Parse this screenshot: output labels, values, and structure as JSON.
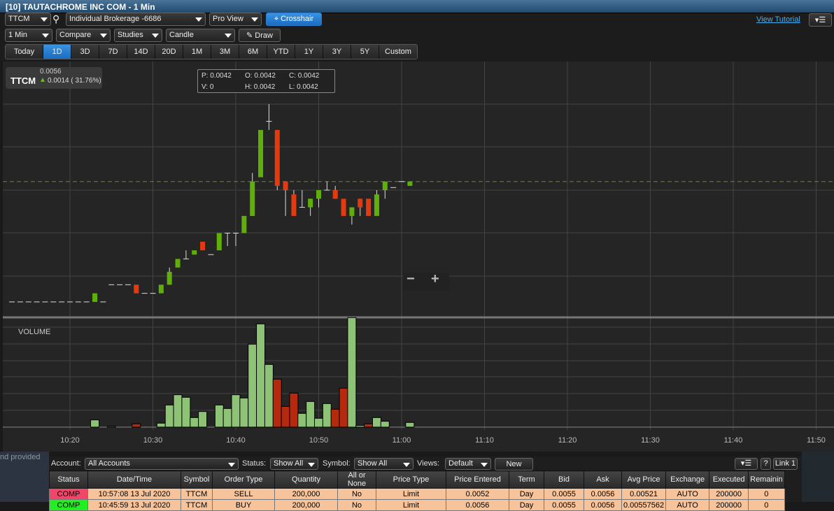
{
  "window_title": "[10] TAUTACHROME INC COM - 1 Min",
  "toolbar": {
    "symbol": "TTCM",
    "account": "Individual Brokerage -6686",
    "view": "Pro View",
    "crosshair": "Crosshair",
    "view_tutorial": "View Tutorial",
    "interval": "1 Min",
    "compare": "Compare",
    "studies": "Studies",
    "chart_type": "Candle",
    "draw": "Draw",
    "ranges": [
      "Today",
      "1D",
      "3D",
      "7D",
      "14D",
      "20D",
      "1M",
      "3M",
      "6M",
      "YTD",
      "1Y",
      "3Y",
      "5Y",
      "Custom"
    ],
    "active_range": "1D"
  },
  "quote": {
    "symbol": "TTCM",
    "last": "0.0056",
    "change": "0.0014 ( 31.76%)"
  },
  "ohlc_box": {
    "p": "P: 0.0042",
    "o": "O: 0.0042",
    "c": "C: 0.0042",
    "v": "V: 0",
    "h": "H: 0.0042",
    "l": "L: 0.0042"
  },
  "zoom": {
    "minus": "−",
    "plus": "+"
  },
  "colors": {
    "up": "#5fae0a",
    "down": "#e43a10",
    "vol_up": "#8dc277",
    "vol_down": "#b52a0e",
    "ref_line": "#6a8a2a"
  },
  "chart_data": {
    "type": "candlestick",
    "volume_label": "VOLUME",
    "reference_price": 0.0056,
    "price_range": [
      0.00385,
      0.00675
    ],
    "x_ticks": [
      "10:20",
      "10:30",
      "10:40",
      "10:50",
      "11:00",
      "11:10",
      "11:20",
      "11:30",
      "11:40",
      "11:50"
    ],
    "candles": [
      [
        13,
        0.0042,
        0.0042,
        0.0042,
        0.0042
      ],
      [
        14,
        0.0042,
        0.0042,
        0.0042,
        0.0042
      ],
      [
        15,
        0.0042,
        0.0042,
        0.0042,
        0.0042
      ],
      [
        16,
        0.0042,
        0.0042,
        0.0042,
        0.0042
      ],
      [
        17,
        0.0042,
        0.0042,
        0.0042,
        0.0042
      ],
      [
        18,
        0.0042,
        0.0042,
        0.0042,
        0.0042
      ],
      [
        19,
        0.0042,
        0.0042,
        0.0042,
        0.0042
      ],
      [
        20,
        0.0042,
        0.0042,
        0.0042,
        0.0042
      ],
      [
        21,
        0.0042,
        0.0042,
        0.0042,
        0.0042
      ],
      [
        22,
        0.0042,
        0.0042,
        0.0042,
        0.0042
      ],
      [
        23,
        0.0042,
        0.0043,
        0.0042,
        0.0043
      ],
      [
        24,
        0.0042,
        0.0042,
        0.0042,
        0.0042
      ],
      [
        25,
        0.0044,
        0.0044,
        0.0044,
        0.0044
      ],
      [
        26,
        0.0044,
        0.0044,
        0.0044,
        0.0044
      ],
      [
        27,
        0.0044,
        0.0044,
        0.0044,
        0.0044
      ],
      [
        28,
        0.0044,
        0.0044,
        0.0043,
        0.0043
      ],
      [
        29,
        0.0043,
        0.0043,
        0.0043,
        0.0043
      ],
      [
        30,
        0.0043,
        0.0043,
        0.0043,
        0.0043
      ],
      [
        31,
        0.0043,
        0.0044,
        0.0043,
        0.0044
      ],
      [
        32,
        0.0044,
        0.0046,
        0.0044,
        0.00455
      ],
      [
        33,
        0.0046,
        0.0047,
        0.0046,
        0.0047
      ],
      [
        34,
        0.0047,
        0.0048,
        0.0047,
        0.0047
      ],
      [
        35,
        0.00475,
        0.0048,
        0.00475,
        0.0048
      ],
      [
        36,
        0.0049,
        0.0049,
        0.0048,
        0.0048
      ],
      [
        37,
        0.00475,
        0.00475,
        0.00475,
        0.00475
      ],
      [
        38,
        0.0048,
        0.005,
        0.0048,
        0.005
      ],
      [
        39,
        0.005,
        0.005,
        0.00485,
        0.005
      ],
      [
        40,
        0.005,
        0.005,
        0.00485,
        0.005
      ],
      [
        41,
        0.005,
        0.0052,
        0.005,
        0.0052
      ],
      [
        42,
        0.0052,
        0.0057,
        0.0052,
        0.0056
      ],
      [
        43,
        0.00565,
        0.0062,
        0.00565,
        0.0062
      ],
      [
        44,
        0.0063,
        0.0065,
        0.0062,
        0.0063
      ],
      [
        45,
        0.0062,
        0.0062,
        0.0055,
        0.00555
      ],
      [
        46,
        0.0056,
        0.0056,
        0.0052,
        0.0055
      ],
      [
        47,
        0.00545,
        0.0055,
        0.0052,
        0.0052
      ],
      [
        48,
        0.0053,
        0.0055,
        0.0053,
        0.0053
      ],
      [
        49,
        0.0053,
        0.0054,
        0.0052,
        0.0054
      ],
      [
        50,
        0.0054,
        0.0055,
        0.0053,
        0.0055
      ],
      [
        51,
        0.0055,
        0.0056,
        0.0055,
        0.0055
      ],
      [
        52,
        0.0055,
        0.00555,
        0.0054,
        0.0054
      ],
      [
        53,
        0.0054,
        0.0054,
        0.0052,
        0.0052
      ],
      [
        54,
        0.0052,
        0.0053,
        0.0051,
        0.0053
      ],
      [
        55,
        0.0054,
        0.0054,
        0.0052,
        0.0053
      ],
      [
        56,
        0.0054,
        0.0054,
        0.0052,
        0.0052
      ],
      [
        57,
        0.0052,
        0.0055,
        0.0052,
        0.00545
      ],
      [
        58,
        0.0055,
        0.0056,
        0.0054,
        0.0056
      ],
      [
        59,
        0.00553,
        0.00553,
        0.00553,
        0.00553
      ],
      [
        60,
        0.0056,
        0.0056,
        0.0056,
        0.0056
      ],
      [
        61,
        0.00555,
        0.0056,
        0.00555,
        0.0056
      ]
    ],
    "volume": [
      [
        23,
        31,
        "up"
      ],
      [
        25,
        4,
        "up"
      ],
      [
        28,
        14,
        "down"
      ],
      [
        31,
        17,
        "up"
      ],
      [
        32,
        95,
        "up"
      ],
      [
        33,
        139,
        "up"
      ],
      [
        34,
        128,
        "up"
      ],
      [
        35,
        41,
        "up"
      ],
      [
        36,
        67,
        "up"
      ],
      [
        38,
        95,
        "up"
      ],
      [
        39,
        80,
        "up"
      ],
      [
        40,
        139,
        "up"
      ],
      [
        41,
        125,
        "up"
      ],
      [
        42,
        356,
        "up"
      ],
      [
        43,
        443,
        "up"
      ],
      [
        44,
        269,
        "up"
      ],
      [
        45,
        206,
        "down"
      ],
      [
        46,
        89,
        "down"
      ],
      [
        47,
        146,
        "down"
      ],
      [
        48,
        59,
        "up"
      ],
      [
        49,
        110,
        "up"
      ],
      [
        50,
        38,
        "up"
      ],
      [
        51,
        101,
        "up"
      ],
      [
        52,
        77,
        "down"
      ],
      [
        53,
        167,
        "down"
      ],
      [
        54,
        470,
        "up"
      ],
      [
        55,
        7,
        "up"
      ],
      [
        56,
        14,
        "down"
      ],
      [
        57,
        41,
        "up"
      ],
      [
        58,
        25,
        "up"
      ],
      [
        61,
        20,
        "up"
      ]
    ]
  },
  "left_note": "nd provided",
  "orders": {
    "account_label": "Account:",
    "account": "All Accounts",
    "status_label": "Status:",
    "status": "Show All",
    "symbol_label": "Symbol:",
    "symbol": "Show All",
    "views_label": "Views:",
    "views": "Default",
    "new": "New",
    "help": "?",
    "link": "Link 1",
    "columns": [
      "Status",
      "Date/Time",
      "Symbol",
      "Order Type",
      "Quantity",
      "All or None",
      "Price Type",
      "Price Entered",
      "Term",
      "Bid",
      "Ask",
      "Avg Price",
      "Exchange",
      "Executed",
      "Remainin"
    ],
    "rows": [
      {
        "status": "COMP",
        "status_color": "#f2456a",
        "cells": [
          "10:57:08 13 Jul 2020",
          "TTCM",
          "SELL",
          "200,000",
          "No",
          "Limit",
          "0.0052",
          "Day",
          "0.0055",
          "0.0056",
          "0.00521",
          "AUTO",
          "200000",
          "0"
        ]
      },
      {
        "status": "COMP",
        "status_color": "#22ee22",
        "cells": [
          "10:45:59 13 Jul 2020",
          "TTCM",
          "BUY",
          "200,000",
          "No",
          "Limit",
          "0.0056",
          "Day",
          "0.0055",
          "0.0056",
          "0.00557562",
          "AUTO",
          "200000",
          "0"
        ]
      }
    ]
  }
}
